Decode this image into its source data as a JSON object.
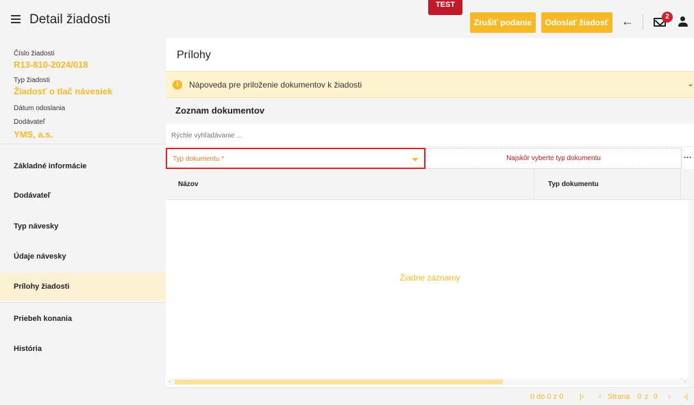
{
  "header": {
    "title": "Detail žiadosti",
    "env_badge": "TEST",
    "cancel_label": "Zrušiť podanie",
    "send_label": "Odoslať žiadosť",
    "mail_count": "2"
  },
  "sidebar": {
    "request_number_label": "Číslo žiadosti",
    "request_number": "R13-810-2024/018",
    "request_type_label": "Typ žiadosti",
    "request_type": "Žiadosť o tlač návesiek",
    "sent_date_label": "Dátum odoslania",
    "supplier_label": "Dodávateľ",
    "supplier": "YMS, a.s.",
    "items": [
      {
        "label": "Základné informácie"
      },
      {
        "label": "Dodávateľ"
      },
      {
        "label": "Typ návesky"
      },
      {
        "label": "Údaje návesky"
      },
      {
        "label": "Prílohy žiadosti",
        "active": true
      },
      {
        "label": "Priebeh konania"
      },
      {
        "label": "História"
      }
    ]
  },
  "main": {
    "title": "Prílohy",
    "help_text": "Nápoveda pre priloženie dokumentov k žiadosti",
    "list_title": "Zoznam dokumentov",
    "search_placeholder": "Rýchle vyhľadávanie ...",
    "doctype_placeholder": "Typ dokumentu *",
    "upload_hint": "Najskôr vyberte typ dokumentu",
    "columns": [
      "Názov",
      "Typ dokumentu"
    ],
    "empty_text": "Žiadne záznamy",
    "pager": {
      "range": "0 do 0 z 0",
      "page_label": "Strana",
      "page": "0",
      "of_label": "z",
      "total_pages": "0"
    }
  },
  "colors": {
    "accent": "#f7b926",
    "error": "#e02424",
    "badge": "#c0192b"
  }
}
